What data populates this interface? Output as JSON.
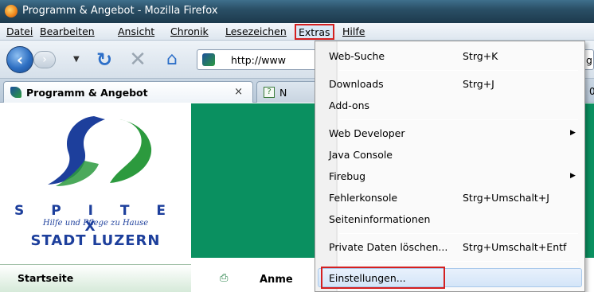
{
  "window": {
    "title": "Programm & Angebot - Mozilla Firefox"
  },
  "menubar": {
    "items": [
      {
        "label": "Datei"
      },
      {
        "label": "Bearbeiten"
      },
      {
        "label": "Ansicht"
      },
      {
        "label": "Chronik"
      },
      {
        "label": "Lesezeichen"
      },
      {
        "label": "Extras"
      },
      {
        "label": "Hilfe"
      }
    ]
  },
  "navbar": {
    "url": "http://www",
    "url_tail": "g"
  },
  "tabs": [
    {
      "label": "Programm & Angebot",
      "close": "×"
    },
    {
      "label": "N",
      "close": ""
    }
  ],
  "tab_overflow": "0",
  "page": {
    "logo_letters": "S P I T E X",
    "logo_tagline": "Hilfe und Pflege zu Hause",
    "logo_city": "STADT LUZERN",
    "nav_item": "Startseite",
    "content_heading": "Anme"
  },
  "extras_menu": {
    "items": [
      {
        "label": "Web-Suche",
        "shortcut": "Strg+K"
      },
      {
        "label": "Downloads",
        "shortcut": "Strg+J"
      },
      {
        "label": "Add-ons",
        "shortcut": ""
      },
      {
        "label": "Web Developer",
        "shortcut": ""
      },
      {
        "label": "Java Console",
        "shortcut": ""
      },
      {
        "label": "Firebug",
        "shortcut": ""
      },
      {
        "label": "Fehlerkonsole",
        "shortcut": "Strg+Umschalt+J"
      },
      {
        "label": "Seiteninformationen",
        "shortcut": ""
      },
      {
        "label": "Private Daten löschen...",
        "shortcut": "Strg+Umschalt+Entf"
      },
      {
        "label": "Einstellungen...",
        "shortcut": ""
      }
    ],
    "highlighted_item": "Einstellungen..."
  },
  "colors": {
    "title_bar": "#2a4f66",
    "page_green": "#0a9060",
    "highlight_red": "#d42020",
    "logo_blue": "#1d3f9c",
    "logo_green": "#2c9a3e"
  }
}
